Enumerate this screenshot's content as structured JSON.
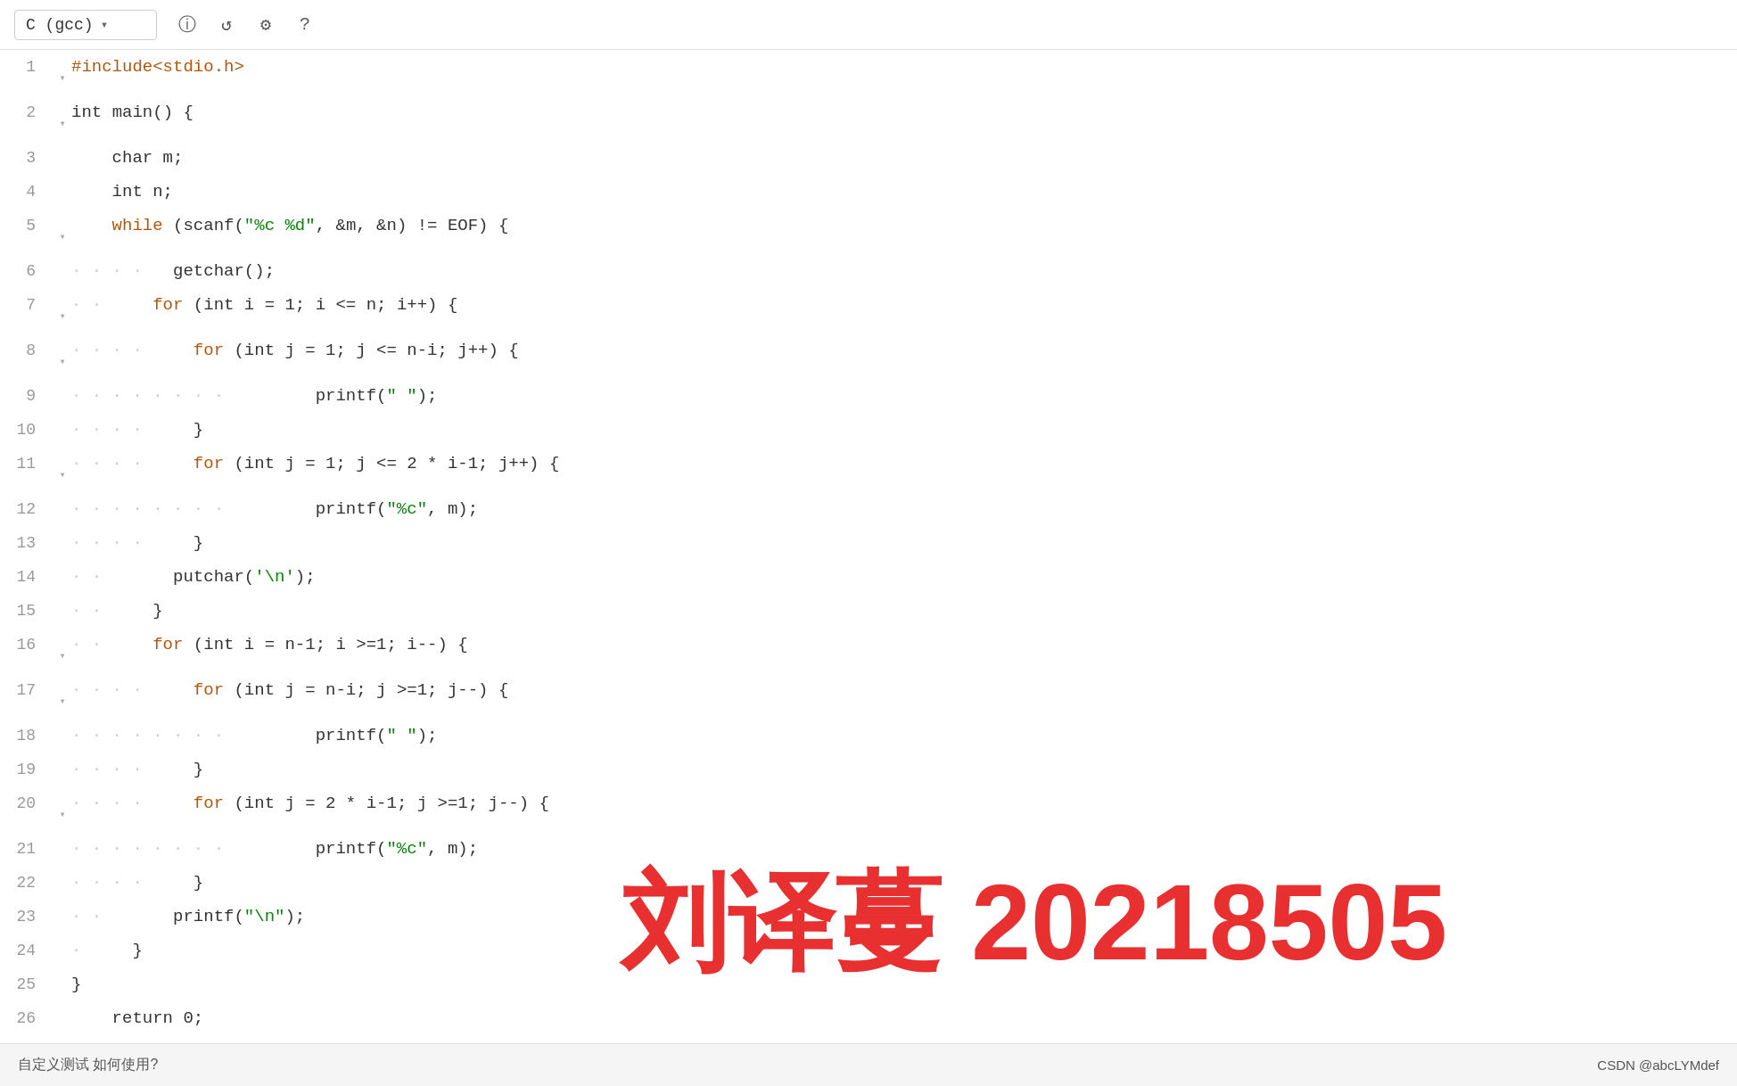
{
  "toolbar": {
    "language": "C (gcc)",
    "chevron": "▾",
    "icons": [
      "ℹ",
      "↺",
      "⚙",
      "?"
    ]
  },
  "lines": [
    {
      "num": 1,
      "fold": "▾",
      "indent": "",
      "code": "#include<stdio.h>",
      "type": "preprocessor"
    },
    {
      "num": 2,
      "fold": "▾",
      "indent": "",
      "code": "int main() {",
      "type": "normal"
    },
    {
      "num": 3,
      "fold": "",
      "indent": "    ",
      "code": "char m;",
      "type": "normal"
    },
    {
      "num": 4,
      "fold": "",
      "indent": "    ",
      "code": "int n;",
      "type": "normal"
    },
    {
      "num": 5,
      "fold": "▾",
      "indent": "    ",
      "code": "while (scanf(\"%c %d\", &m, &n) != EOF) {",
      "type": "while"
    },
    {
      "num": 6,
      "fold": "",
      "indent": "      ",
      "code": "getchar();",
      "type": "normal"
    },
    {
      "num": 7,
      "fold": "▾",
      "indent": "      ",
      "code": "for (int i = 1; i <= n; i++) {",
      "type": "for"
    },
    {
      "num": 8,
      "fold": "▾",
      "indent": "         ",
      "code": "for (int j = 1; j <= n-i; j++) {",
      "type": "for"
    },
    {
      "num": 9,
      "fold": "",
      "indent": "            ",
      "code": "printf(\" \");",
      "type": "normal"
    },
    {
      "num": 10,
      "fold": "",
      "indent": "         ",
      "code": "}",
      "type": "normal"
    },
    {
      "num": 11,
      "fold": "▾",
      "indent": "         ",
      "code": "for (int j = 1; j <= 2 * i-1; j++) {",
      "type": "for"
    },
    {
      "num": 12,
      "fold": "",
      "indent": "            ",
      "code": "printf(\"%c\", m);",
      "type": "normal"
    },
    {
      "num": 13,
      "fold": "",
      "indent": "         ",
      "code": "}",
      "type": "normal"
    },
    {
      "num": 14,
      "fold": "",
      "indent": "      ",
      "code": "putchar('\\n');",
      "type": "normal"
    },
    {
      "num": 15,
      "fold": "",
      "indent": "   ",
      "code": "}",
      "type": "normal"
    },
    {
      "num": 16,
      "fold": "▾",
      "indent": "      ",
      "code": "for (int i = n-1; i >=1; i--) {",
      "type": "for"
    },
    {
      "num": 17,
      "fold": "▾",
      "indent": "         ",
      "code": "for (int j = n-i; j >=1; j--) {",
      "type": "for"
    },
    {
      "num": 18,
      "fold": "",
      "indent": "            ",
      "code": "printf(\" \");",
      "type": "normal"
    },
    {
      "num": 19,
      "fold": "",
      "indent": "         ",
      "code": "}",
      "type": "normal"
    },
    {
      "num": 20,
      "fold": "▾",
      "indent": "         ",
      "code": "for (int j = 2 * i-1; j >=1; j--) {",
      "type": "for"
    },
    {
      "num": 21,
      "fold": "",
      "indent": "            ",
      "code": "printf(\"%c\", m);",
      "type": "normal"
    },
    {
      "num": 22,
      "fold": "",
      "indent": "         ",
      "code": "}",
      "type": "normal"
    },
    {
      "num": 23,
      "fold": "",
      "indent": "      ",
      "code": "printf(\"\\n\");",
      "type": "normal"
    },
    {
      "num": 24,
      "fold": "",
      "indent": "   ",
      "code": "}",
      "type": "normal"
    },
    {
      "num": 25,
      "fold": "",
      "indent": "",
      "code": "}",
      "type": "normal"
    },
    {
      "num": 26,
      "fold": "",
      "indent": "    ",
      "code": "return 0;",
      "type": "normal"
    }
  ],
  "watermark": {
    "text": "刘译蔓 20218505"
  },
  "bottom": {
    "left_text": "自定义测试 如何使用?",
    "right_text": "CSDN @abcLYMdef"
  }
}
